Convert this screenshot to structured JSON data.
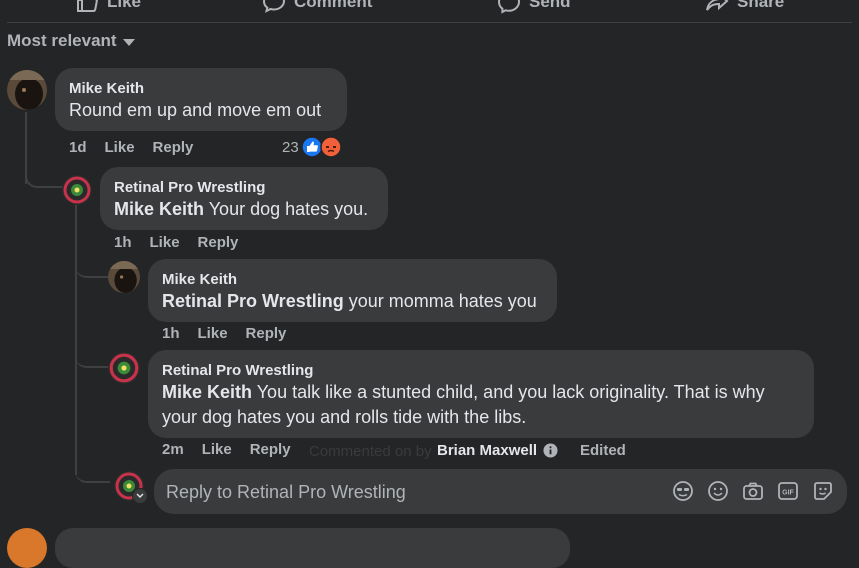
{
  "top_actions": {
    "like": "Like",
    "comment": "Comment",
    "send": "Send",
    "share": "Share"
  },
  "sort": {
    "label": "Most relevant"
  },
  "comments": [
    {
      "author": "Mike Keith",
      "text": "Round em up and move em out",
      "time": "1d",
      "like": "Like",
      "reply": "Reply",
      "reactions_count": "23"
    },
    {
      "author": "Retinal Pro Wrestling",
      "mention": "Mike Keith",
      "text": " Your dog hates you.",
      "time": "1h",
      "like": "Like",
      "reply": "Reply"
    },
    {
      "author": "Mike Keith",
      "mention": "Retinal Pro Wrestling",
      "text": " your momma hates you",
      "time": "1h",
      "like": "Like",
      "reply": "Reply"
    },
    {
      "author": "Retinal Pro Wrestling",
      "mention": "Mike Keith",
      "text_line1": " You talk like a stunted child, and you lack originality. That is why",
      "text_line2": "your dog hates you and rolls tide with the libs.",
      "time": "2m",
      "like": "Like",
      "reply": "Reply",
      "commented_on_by": "Commented on by",
      "commenter": "Brian Maxwell",
      "edited": "Edited"
    }
  ],
  "reply_box": {
    "placeholder": "Reply to Retinal Pro Wrestling"
  },
  "colors": {
    "like_blue": "#1877f2",
    "angry_orange": "#f2603a",
    "bg": "#242526",
    "bubble": "#3a3b3c"
  }
}
